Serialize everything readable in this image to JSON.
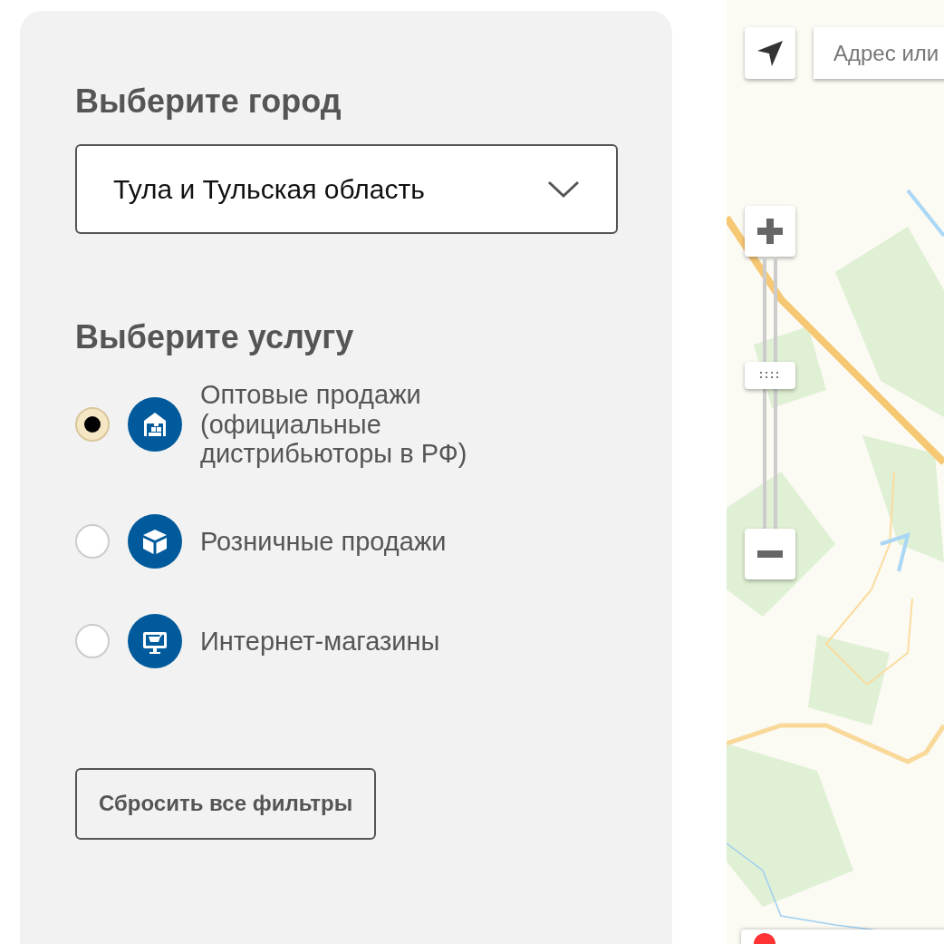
{
  "city_filter": {
    "heading": "Выберите город",
    "select": {
      "value": "Тула и Тульская область"
    }
  },
  "service_filter": {
    "heading": "Выберите услугу",
    "options": [
      {
        "label": "Оптовые продажи (официальные дистрибьюторы в РФ)",
        "kind": "warehouse",
        "selected": true
      },
      {
        "label": "Розничные продажи",
        "kind": "box",
        "selected": false
      },
      {
        "label": "Интернет-магазины",
        "kind": "monitor-cart",
        "selected": false
      }
    ]
  },
  "reset_button": {
    "label": "Сбросить все фильтры"
  },
  "map": {
    "search": {
      "placeholder": "Адрес или"
    },
    "zoom": {
      "level": 0.57
    }
  }
}
